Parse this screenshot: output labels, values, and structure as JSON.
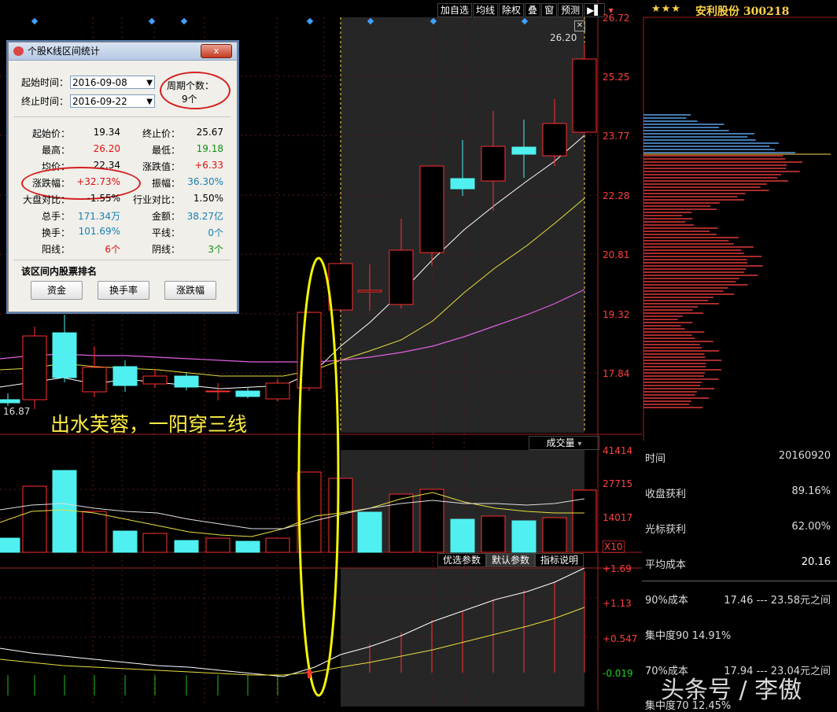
{
  "toolbar": {
    "items": [
      "加自选",
      "均线",
      "除权",
      "叠",
      "窗",
      "预测"
    ],
    "pin_label": "▶▌",
    "dropdown_label": "▾"
  },
  "chart": {
    "price_max_label": "26.72",
    "price_axis": [
      "26.72",
      "25.25",
      "23.77",
      "22.28",
      "20.81",
      "19.32",
      "17.84"
    ],
    "high_marker": "26.20",
    "low_marker": "16.87",
    "caption": "出水芙蓉，一阳穿三线",
    "volume_label": "成交量",
    "volume_axis": [
      "41414",
      "27715",
      "14017"
    ],
    "volume_unit": "X10",
    "indicator_axis": [
      "+1.69",
      "+1.13",
      "+0.547",
      "-0.019"
    ],
    "indicator_tabs": [
      "优选参数",
      "默认参数",
      "指标说明"
    ]
  },
  "stock": {
    "stars": "★★★",
    "name": "安利股份 300218"
  },
  "right_info": {
    "time_label": "时间",
    "time_value": "20160920",
    "close_profit_label": "收盘获利",
    "close_profit_value": "89.16%",
    "cursor_profit_label": "光标获利",
    "cursor_profit_value": "62.00%",
    "avg_cost_label": "平均成本",
    "avg_cost_value": "20.16",
    "cost90_label": "90%成本",
    "cost90_value": "17.46 --- 23.58元之间",
    "conc90_label": "集中度90",
    "conc90_value": "14.91%",
    "cost70_label": "70%成本",
    "cost70_value": "17.94 --- 23.04元之间",
    "conc70_label": "集中度70",
    "conc70_value": "12.45%"
  },
  "dialog": {
    "title": "个股K线区间统计",
    "close_label": "x",
    "start_time_label": "起始时间：",
    "start_time_value": "2016-09-08",
    "end_time_label": "终止时间：",
    "end_time_value": "2016-09-22",
    "period_label": "周期个数：",
    "period_value": "9个",
    "stats": {
      "start_price_label": "起始价：",
      "start_price": "19.34",
      "end_price_label": "终止价：",
      "end_price": "25.67",
      "high_label": "最高：",
      "high": "26.20",
      "low_label": "最低：",
      "low": "19.18",
      "avg_label": "均价：",
      "avg": "22.34",
      "change_label": "涨跌值：",
      "change": "+6.33",
      "pct_label": "涨跌幅：",
      "pct": "+32.73%",
      "amp_label": "振幅：",
      "amp": "36.30%",
      "market_cmp_label": "大盘对比：",
      "market_cmp": "-1.55%",
      "industry_cmp_label": "行业对比：",
      "industry_cmp": "1.50%",
      "vol_label": "总手：",
      "vol": "171.34万",
      "amount_label": "金额：",
      "amount": "38.27亿",
      "turnover_label": "换手：",
      "turnover": "101.69%",
      "flat_label": "平线：",
      "flat": "0个",
      "up_label": "阳线：",
      "up": "6个",
      "down_label": "阴线：",
      "down": "3个"
    },
    "rank_title": "该区间内股票排名",
    "buttons": [
      "资金",
      "换手率",
      "涨跌幅"
    ]
  },
  "watermark": "头条号 / 李傲"
}
